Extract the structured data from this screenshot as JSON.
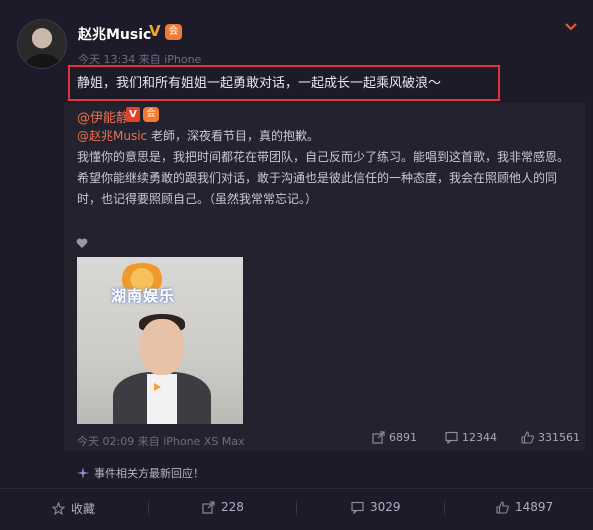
{
  "post": {
    "author": "赵兆Music",
    "v_badge": "V",
    "member_badge": "会",
    "meta": "今天 13:34 来自 iPhone",
    "text": "静姐，我们和所有姐姐一起勇敢对话，一起成长一起乘风破浪～"
  },
  "repost": {
    "author": "@伊能静",
    "v_badge": "V",
    "member_badge": "会",
    "mention": "@赵兆Music",
    "line1_rest": " 老師，深夜看节目，真的抱歉。",
    "line2": "我懂你的意思是，我把时间都花在带团队，自己反而少了练习。能唱到这首歌，我非常感恩。",
    "line3": "希望你能继续勇敢的跟我们对话，敢于沟通也是彼此信任的一种态度，我会在照顾他人的同",
    "line4": "时，也记得要照顾自己。（虽然我常常忘记。）",
    "video_logo": "湖南娱乐",
    "meta": "今天 02:09 来自 iPhone XS Max",
    "shares": "6891",
    "comments": "12344",
    "likes": "331561"
  },
  "event_notice": "事件相关方最新回应！",
  "actions": {
    "favorite": "收藏",
    "share": "228",
    "comment": "3029",
    "like": "14897"
  },
  "colors": {
    "background": "#1d1a29",
    "repost_background": "#25222f",
    "highlight_border": "#e2343a",
    "link": "#eb7350",
    "vip_gold": "#f5a623"
  },
  "icons": [
    "avatar",
    "chevron-down-icon",
    "heart-icon",
    "play-icon",
    "share-icon",
    "comment-icon",
    "like-icon",
    "sparkle-icon",
    "star-icon"
  ]
}
